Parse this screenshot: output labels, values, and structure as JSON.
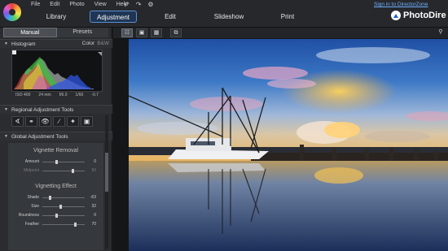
{
  "app": {
    "brand": "PhotoDire",
    "signin": "Sign in to DirectorZone",
    "menu": [
      "File",
      "Edit",
      "Photo",
      "View",
      "Help"
    ],
    "undo_icons": [
      "undo-icon",
      "redo-icon",
      "settings-icon"
    ],
    "window_icons": [
      "minimize-icon",
      "close-icon"
    ]
  },
  "main_tabs": [
    {
      "label": "Library",
      "active": false
    },
    {
      "label": "Adjustment",
      "active": true
    },
    {
      "label": "Edit",
      "active": false
    },
    {
      "label": "Slideshow",
      "active": false
    },
    {
      "label": "Print",
      "active": false
    }
  ],
  "panel": {
    "tabs": [
      {
        "label": "Manual",
        "active": true
      },
      {
        "label": "Presets",
        "active": false
      }
    ],
    "histogram": {
      "title": "Histogram",
      "color_label": "Color",
      "bw_label": "B&W",
      "exif": [
        "ISO 400",
        "24 mm",
        "f/6.0",
        "1/60",
        "-0.7"
      ]
    },
    "regional": {
      "title": "Regional Adjustment Tools",
      "tools": [
        "crop-angle-icon",
        "spot-removal-icon",
        "red-eye-icon",
        "brush-icon",
        "gradient-brush-icon",
        "radial-filter-icon"
      ]
    },
    "global": {
      "title": "Global Adjustment Tools",
      "groups": [
        {
          "title": "Vignette Removal",
          "sliders": [
            {
              "label": "Amount",
              "value": "0",
              "pos": 0.3,
              "dim": false
            },
            {
              "label": "Midpoint",
              "value": "50",
              "pos": 0.7,
              "dim": true
            }
          ]
        },
        {
          "title": "Vignetting Effect",
          "sliders": [
            {
              "label": "Shade",
              "value": "-63",
              "pos": 0.16,
              "dim": false
            },
            {
              "label": "Size",
              "value": "32",
              "pos": 0.4,
              "dim": false
            },
            {
              "label": "Roundness",
              "value": "0",
              "pos": 0.3,
              "dim": false
            },
            {
              "label": "Feather",
              "value": "70",
              "pos": 0.75,
              "dim": false
            }
          ]
        }
      ]
    }
  },
  "viewer": {
    "tool_icons": [
      "compare-before-after-icon",
      "single-view-icon",
      "grid-view-icon",
      "fullscreen-icon",
      "zoom-icon"
    ]
  }
}
